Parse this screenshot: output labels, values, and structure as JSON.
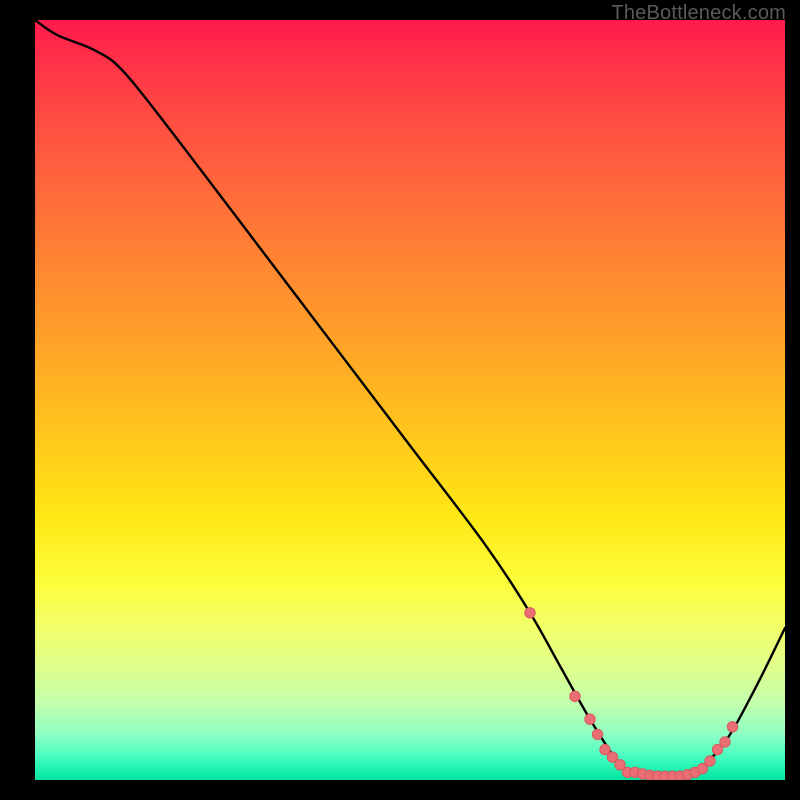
{
  "attribution": "TheBottleneck.com",
  "colors": {
    "background": "#000000",
    "curve": "#000000",
    "marker_fill": "#e96f74",
    "marker_stroke": "#d8585e"
  },
  "chart_data": {
    "type": "line",
    "title": "",
    "xlabel": "",
    "ylabel": "",
    "xlim": [
      0,
      100
    ],
    "ylim": [
      0,
      100
    ],
    "series": [
      {
        "name": "bottleneck-curve",
        "x": [
          0,
          3,
          8,
          12,
          20,
          30,
          40,
          50,
          60,
          66,
          70,
          74,
          78,
          80,
          82,
          84,
          86,
          88,
          92,
          96,
          100
        ],
        "values": [
          100,
          98,
          96,
          93,
          83,
          70,
          57,
          44,
          31,
          22,
          15,
          8,
          2,
          1,
          0.5,
          0.5,
          0.5,
          1,
          5,
          12,
          20
        ]
      }
    ],
    "markers": {
      "name": "highlighted-points",
      "x": [
        66,
        72,
        74,
        75,
        76,
        77,
        78,
        79,
        80,
        81,
        82,
        83,
        84,
        85,
        86,
        87,
        88,
        89,
        90,
        91,
        92,
        93
      ],
      "values": [
        22,
        11,
        8,
        6,
        4,
        3,
        2,
        1,
        1,
        0.8,
        0.6,
        0.5,
        0.5,
        0.5,
        0.5,
        0.7,
        1,
        1.5,
        2.5,
        4,
        5,
        7
      ]
    }
  }
}
